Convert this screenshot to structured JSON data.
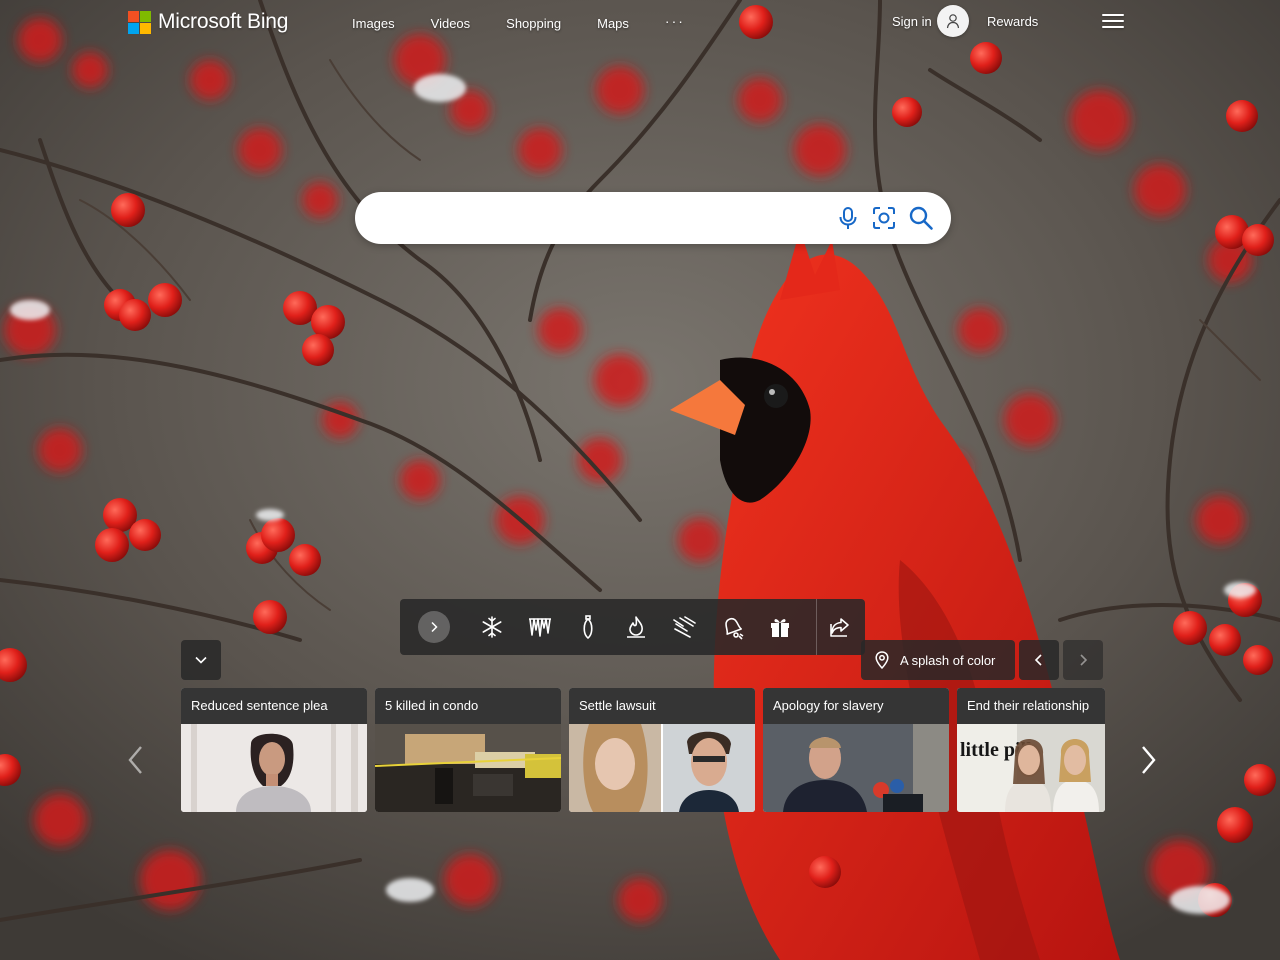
{
  "header": {
    "brand": "Microsoft Bing",
    "nav": [
      "Images",
      "Videos",
      "Shopping",
      "Maps",
      "···"
    ],
    "sign_in": "Sign in",
    "rewards": "Rewards"
  },
  "brand_colors": {
    "red": "#f25022",
    "green": "#7fba00",
    "blue": "#00a4ef",
    "yellow": "#ffb900"
  },
  "search": {
    "value": "",
    "placeholder": ""
  },
  "icons": {
    "search_box": [
      "microphone-icon",
      "visual-search-icon",
      "search-icon"
    ],
    "toolbar": [
      "snowflake-icon",
      "icicles-icon",
      "ornament-icon",
      "flame-icon",
      "snowfall-icon",
      "bell-icon",
      "gift-icon",
      "share-icon"
    ]
  },
  "image_info": {
    "title": "A splash of color"
  },
  "news": [
    {
      "title": "Reduced sentence plea"
    },
    {
      "title": "5 killed in condo"
    },
    {
      "title": "Settle lawsuit"
    },
    {
      "title": "Apology for slavery"
    },
    {
      "title": "End their relationship"
    }
  ],
  "news_image_text": {
    "poster": "little pill"
  }
}
